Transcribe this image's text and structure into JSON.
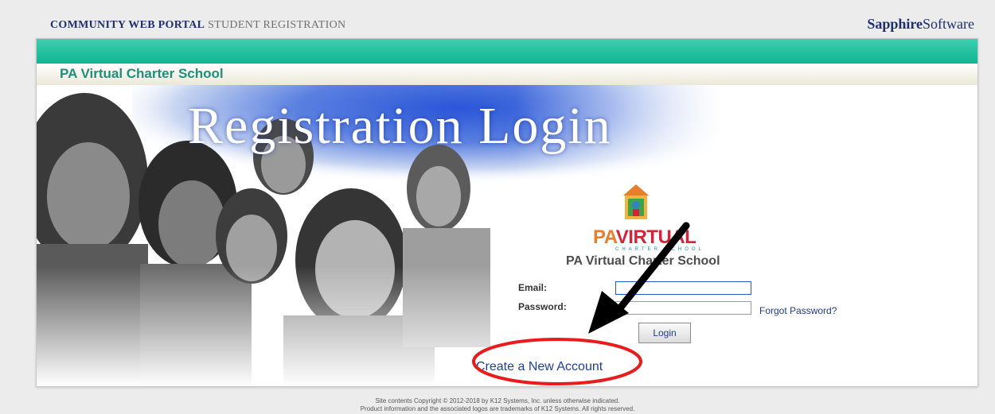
{
  "header": {
    "portal_title": "COMMUNITY WEB PORTAL",
    "portal_subtitle": "STUDENT REGISTRATION",
    "brand_bold": "Sapphire",
    "brand_regular": "Software"
  },
  "school_bar": {
    "name": "PA Virtual Charter School"
  },
  "hero": {
    "title": "Registration Login"
  },
  "logo": {
    "text_pa": "PA",
    "text_virtual": "VIRTUAL",
    "tagline": "CHARTER SCHOOL",
    "school_name": "PA Virtual Charter School"
  },
  "form": {
    "email_label": "Email:",
    "email_value": "",
    "password_label": "Password:",
    "password_value": "",
    "forgot_link": "Forgot Password?",
    "login_button": "Login",
    "create_account_link": "Create a New Account"
  },
  "footer": {
    "line1": "Site contents Copyright © 2012-2018 by K12 Systems, Inc. unless otherwise indicated.",
    "line2": "Product information and the associated logos are trademarks of K12 Systems.  All rights reserved."
  },
  "colors": {
    "teal_bar": "#11b491",
    "school_text": "#1e8f7a",
    "navy": "#1e2f70",
    "annotation": "#e81c1c"
  }
}
